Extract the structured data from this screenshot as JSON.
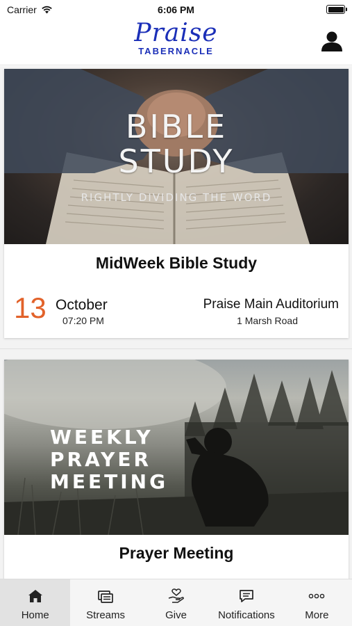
{
  "status": {
    "carrier": "Carrier",
    "time": "6:06 PM"
  },
  "header": {
    "logo_script": "Praise",
    "logo_sub": "TABERNACLE"
  },
  "events": [
    {
      "image_title_line1": "BIBLE",
      "image_title_line2": "STUDY",
      "image_tagline": "RIGHTLY DIVIDING THE WORD",
      "title": "MidWeek Bible Study",
      "day": "13",
      "month": "October",
      "time": "07:20 PM",
      "venue": "Praise Main Auditorium",
      "address": "1 Marsh Road"
    },
    {
      "image_title_line1": "WEEKLY",
      "image_title_line2": "PRAYER",
      "image_title_line3": "MEETING",
      "title": "Prayer Meeting"
    }
  ],
  "tabs": [
    {
      "label": "Home",
      "icon": "home-icon"
    },
    {
      "label": "Streams",
      "icon": "streams-icon"
    },
    {
      "label": "Give",
      "icon": "give-icon"
    },
    {
      "label": "Notifications",
      "icon": "notifications-icon"
    },
    {
      "label": "More",
      "icon": "more-icon"
    }
  ],
  "colors": {
    "brand": "#1b2fb8",
    "date_accent": "#e2622a"
  }
}
